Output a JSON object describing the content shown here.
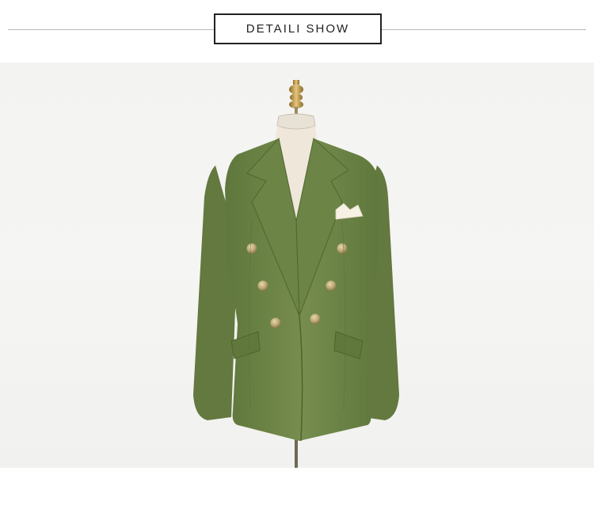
{
  "header": {
    "title": "DETAILI SHOW"
  },
  "photo": {
    "subject": "jacket-on-mannequin",
    "jacket_color": "#6f8648",
    "button_color": "#c2ae7a",
    "background_color": "#f3f3f1"
  }
}
